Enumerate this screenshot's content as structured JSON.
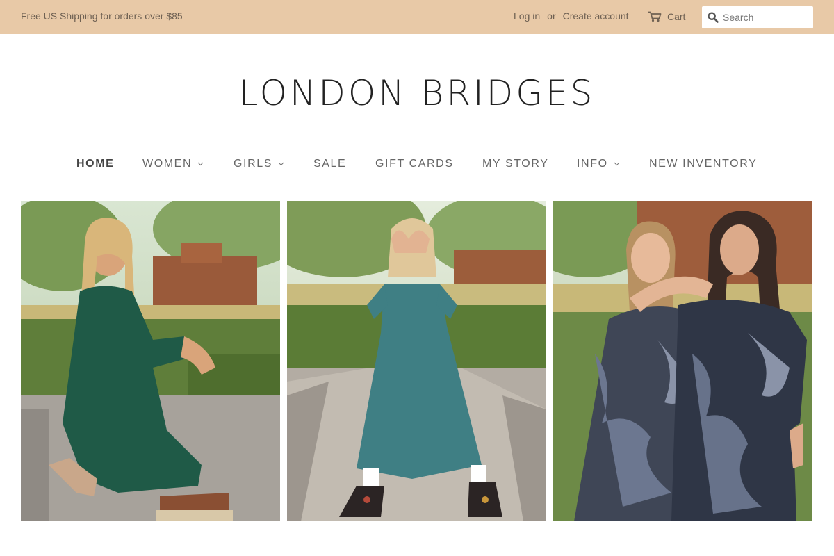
{
  "announcement": "Free US Shipping for orders over $85",
  "account": {
    "login": "Log in",
    "or": "or",
    "create": "Create account"
  },
  "cart": {
    "label": "Cart",
    "icon": "cart-icon"
  },
  "search": {
    "placeholder": "Search",
    "icon": "search-icon"
  },
  "logo": "LONDON BRIDGES",
  "nav": [
    {
      "label": "HOME",
      "active": true,
      "dropdown": false
    },
    {
      "label": "WOMEN",
      "active": false,
      "dropdown": true
    },
    {
      "label": "GIRLS",
      "active": false,
      "dropdown": true
    },
    {
      "label": "SALE",
      "active": false,
      "dropdown": false
    },
    {
      "label": "GIFT CARDS",
      "active": false,
      "dropdown": false
    },
    {
      "label": "MY STORY",
      "active": false,
      "dropdown": false
    },
    {
      "label": "INFO",
      "active": false,
      "dropdown": true
    },
    {
      "label": "NEW INVENTORY",
      "active": false,
      "dropdown": false
    }
  ],
  "colors": {
    "topbar": "#e8c9a7",
    "topbar_text": "#6f6153",
    "logo": "#222222",
    "nav_text": "#666666"
  }
}
